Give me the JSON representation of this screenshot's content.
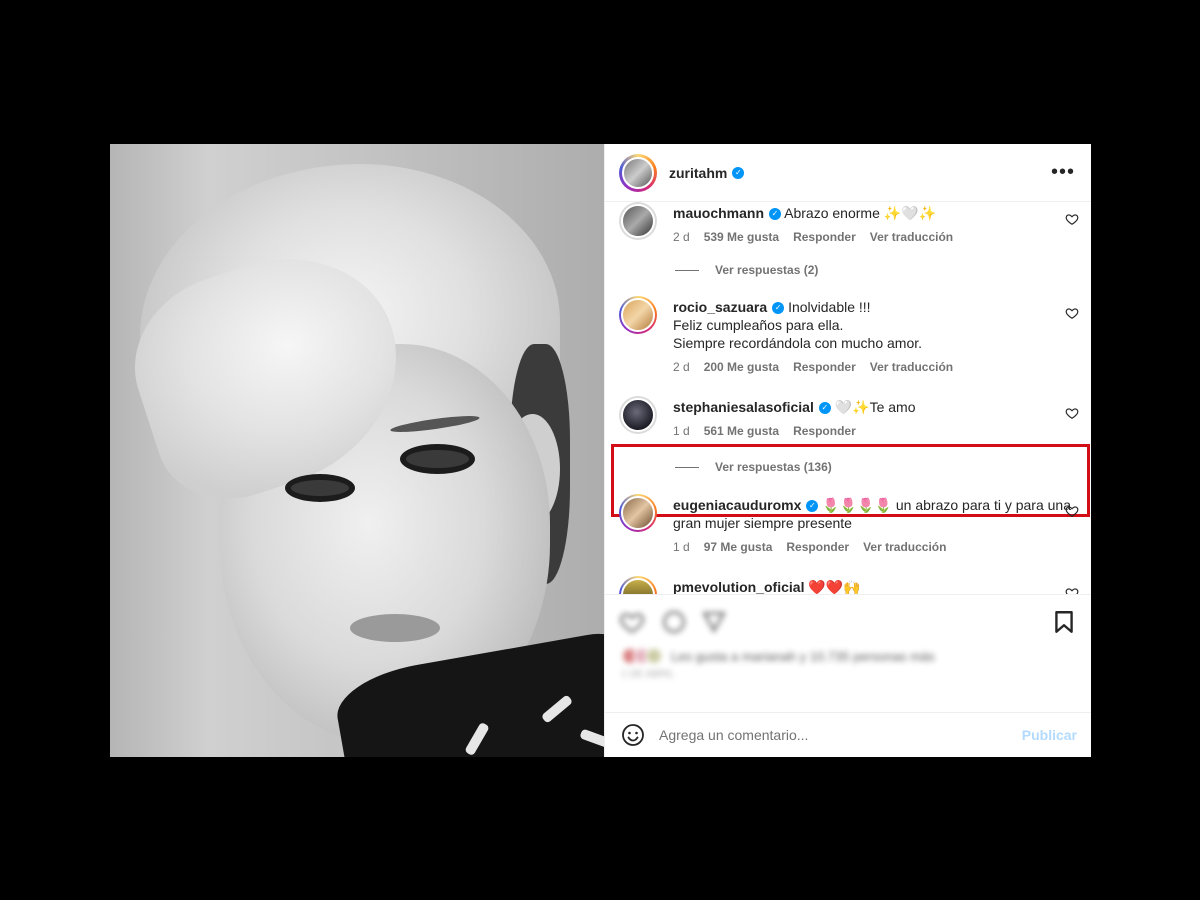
{
  "post": {
    "author": "zuritahm",
    "more_icon": "more-horizontal-icon"
  },
  "comments": [
    {
      "user": "mauochmann",
      "text": "Abrazo enorme ✨🤍✨",
      "age": "2 d",
      "likes": "539 Me gusta",
      "reply": "Responder",
      "translate": "Ver traducción",
      "view_replies": "Ver respuestas (2)"
    },
    {
      "user": "rocio_sazuara",
      "text_lines": [
        "Inolvidable !!!",
        "Feliz cumpleaños para ella.",
        "Siempre recordándola con mucho amor."
      ],
      "age": "2 d",
      "likes": "200 Me gusta",
      "reply": "Responder",
      "translate": "Ver traducción"
    },
    {
      "user": "stephaniesalasoficial",
      "text": "🤍✨Te amo",
      "age": "1 d",
      "likes": "561 Me gusta",
      "reply": "Responder",
      "view_replies": "Ver respuestas (136)"
    },
    {
      "user": "eugeniacauduromx",
      "text_lines": [
        "🌷🌷🌷🌷 un abrazo para ti y para una",
        "gran mujer siempre presente"
      ],
      "age": "1 d",
      "likes": "97 Me gusta",
      "reply": "Responder",
      "translate": "Ver traducción"
    },
    {
      "user": "pmevolution_oficial",
      "text": "❤️❤️🙌"
    }
  ],
  "actions": {
    "likes_summary": "Les gusta a marianah y 10.735 personas más",
    "date": "1 DE ABRIL"
  },
  "add_comment": {
    "placeholder": "Agrega un comentario...",
    "publish": "Publicar"
  },
  "colors": {
    "highlight": "#d20d15",
    "verified": "#0095f6",
    "publish_disabled": "#b3dbff"
  }
}
